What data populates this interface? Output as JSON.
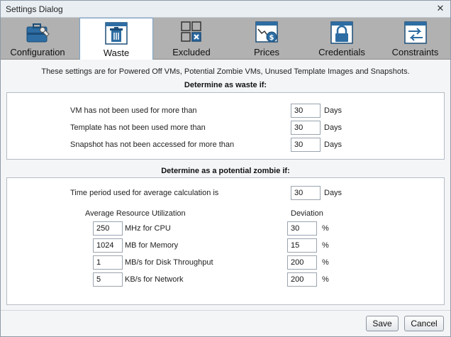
{
  "window": {
    "title": "Settings Dialog",
    "close_glyph": "✕"
  },
  "tabs": [
    {
      "label": "Configuration",
      "icon": "briefcase-wrench-icon",
      "active": false
    },
    {
      "label": "Waste",
      "icon": "trash-icon",
      "active": true
    },
    {
      "label": "Excluded",
      "icon": "excluded-grid-icon",
      "active": false
    },
    {
      "label": "Prices",
      "icon": "dollar-chart-icon",
      "active": false
    },
    {
      "label": "Credentials",
      "icon": "lock-icon",
      "active": false
    },
    {
      "label": "Constraints",
      "icon": "arrows-icon",
      "active": false
    }
  ],
  "intro": "These settings are for Powered Off VMs, Potential Zombie VMs, Unused Template Images and Snapshots.",
  "waste": {
    "heading": "Determine as waste if:",
    "rows": [
      {
        "label": "VM has not been used for more than",
        "value": "30",
        "unit": "Days"
      },
      {
        "label": "Template has not been used more than",
        "value": "30",
        "unit": "Days"
      },
      {
        "label": "Snapshot has not been accessed for more than",
        "value": "30",
        "unit": "Days"
      }
    ]
  },
  "zombie": {
    "heading": "Determine as a potential zombie if:",
    "period": {
      "label": "Time period used for average calculation is",
      "value": "30",
      "unit": "Days"
    },
    "util_header": "Average Resource Utilization",
    "dev_header": "Deviation",
    "rows": [
      {
        "value": "250",
        "label": "MHz for CPU",
        "deviation": "30",
        "unit": "%"
      },
      {
        "value": "1024",
        "label": "MB for Memory",
        "deviation": "15",
        "unit": "%"
      },
      {
        "value": "1",
        "label": "MB/s for Disk Throughput",
        "deviation": "200",
        "unit": "%"
      },
      {
        "value": "5",
        "label": "KB/s for Network",
        "deviation": "200",
        "unit": "%"
      }
    ]
  },
  "footer": {
    "save_label": "Save",
    "cancel_label": "Cancel"
  },
  "colors": {
    "tabbar": "#b1b1b1",
    "icon_blue": "#2d6da3",
    "accent": "#7aa3c8"
  }
}
